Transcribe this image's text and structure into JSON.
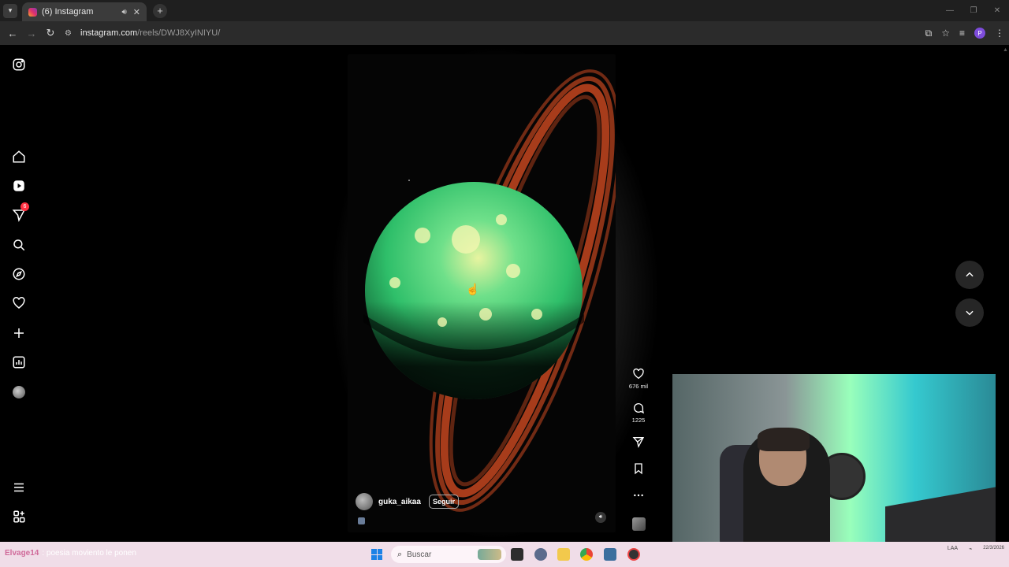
{
  "browser": {
    "tab_title": "(6) Instagram",
    "url_host": "instagram.com",
    "url_path": "/reels/DWJ8XyINIYU/",
    "profile_initial": "P"
  },
  "sidebar": {
    "notifications_badge": "6"
  },
  "reel": {
    "username": "guka_aikaa",
    "follow_label": "Seguir",
    "likes": "676 mil",
    "comments": "1225"
  },
  "taskbar": {
    "ticker_user": "Elvage14",
    "ticker_message": ": poesia moviento le ponen",
    "search_placeholder": "Buscar",
    "tray_lang": "LAA",
    "date": "22/3/2026"
  },
  "colors": {
    "planet": "#2fbf6a",
    "rings": "#b9431e",
    "notification_badge": "#ff3040",
    "taskbar": "#f0dde8"
  }
}
